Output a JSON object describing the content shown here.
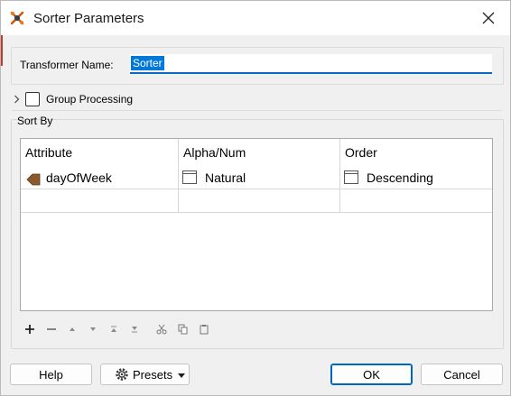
{
  "window": {
    "title": "Sorter Parameters",
    "icons": {
      "app": "transformer-icon",
      "close": "close-icon"
    }
  },
  "transformer_name": {
    "label": "Transformer Name:",
    "value": "Sorter",
    "selected": true
  },
  "group_processing": {
    "label": "Group Processing",
    "checked": false,
    "expanded": false
  },
  "sort_by": {
    "label": "Sort By",
    "columns": [
      "Attribute",
      "Alpha/Num",
      "Order"
    ],
    "rows": [
      {
        "attribute": "dayOfWeek",
        "alpha_num": "Natural",
        "order": "Descending"
      }
    ]
  },
  "toolbar": {
    "icons": [
      "add-icon",
      "remove-icon",
      "move-up-icon",
      "move-down-icon",
      "move-top-icon",
      "move-bottom-icon",
      "cut-icon",
      "copy-icon",
      "paste-icon"
    ]
  },
  "buttons": {
    "help": "Help",
    "presets": "Presets",
    "ok": "OK",
    "cancel": "Cancel"
  },
  "colors": {
    "selection": "#0078d7",
    "input_underline": "#0a66c2",
    "ok_border": "#0067c0",
    "attribute_icon": "#8b5a2b"
  }
}
